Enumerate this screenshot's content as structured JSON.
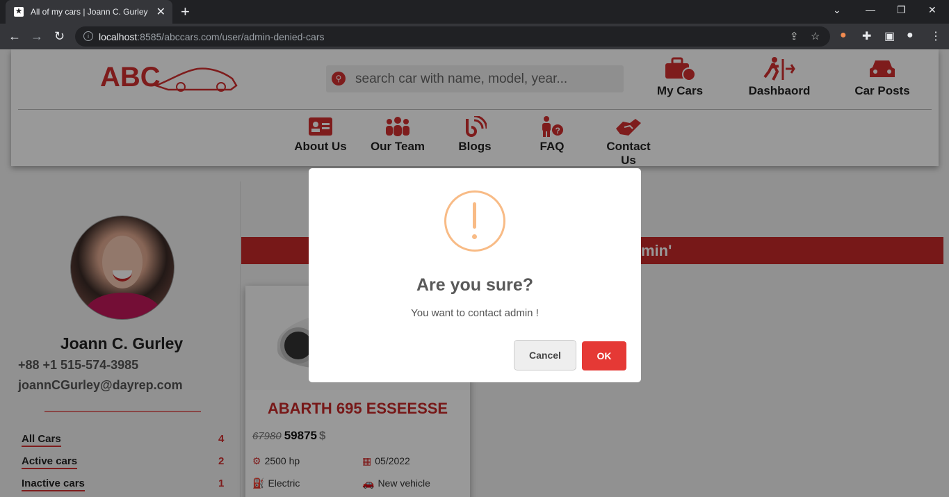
{
  "browser": {
    "tab_title": "All of my cars | Joann C. Gurley",
    "url_host": "localhost",
    "url_rest": ":8585/abccars.com/user/admin-denied-cars"
  },
  "header": {
    "logo_text": "ABC",
    "search_placeholder": "search car with name, model, year...",
    "top_nav": [
      {
        "label": "My Cars",
        "icon": "briefcase-clock-icon"
      },
      {
        "label": "Dashbaord",
        "icon": "running-exit-icon"
      },
      {
        "label": "Car Posts",
        "icon": "car-icon"
      }
    ],
    "sub_nav": [
      {
        "label": "About Us",
        "icon": "id-card-icon"
      },
      {
        "label": "Our Team",
        "icon": "team-icon"
      },
      {
        "label": "Blogs",
        "icon": "blog-icon"
      },
      {
        "label": "FAQ",
        "icon": "person-question-icon"
      },
      {
        "label": "Contact Us",
        "icon": "handshake-icon"
      }
    ]
  },
  "profile": {
    "name": "Joann C. Gurley",
    "phone": "+88 +1 515-574-3985",
    "email": "joannCGurley@dayrep.com",
    "links": [
      {
        "label": "All Cars",
        "count": "4"
      },
      {
        "label": "Active cars",
        "count": "2"
      },
      {
        "label": "Inactive cars",
        "count": "1"
      }
    ]
  },
  "main": {
    "banner_text": "min'"
  },
  "car_card": {
    "title": "ABARTH 695 ESSEESSE",
    "old_price": "67980",
    "price": "59875",
    "currency": "$",
    "power": "2500 hp",
    "date": "05/2022",
    "fuel": "Electric",
    "condition": "New vehicle"
  },
  "modal": {
    "title": "Are you sure?",
    "text": "You want to contact admin !",
    "cancel_label": "Cancel",
    "ok_label": "OK",
    "icon_color": "#f8bb86",
    "ok_color": "#e53935"
  },
  "colors": {
    "accent": "#d32f2f"
  }
}
